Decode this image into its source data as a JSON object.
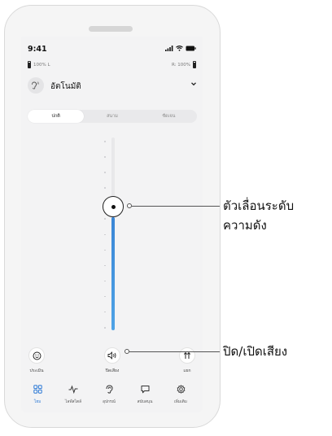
{
  "status_bar": {
    "time": "9:41"
  },
  "battery": {
    "left_label": "100% L",
    "right_label": "R: 100%"
  },
  "program": {
    "label": "อัตโนมัติ"
  },
  "tabs_segment": [
    {
      "label": "ปกติ",
      "active": true
    },
    {
      "label": "สนาม",
      "active": false
    },
    {
      "label": "ชัดเจน",
      "active": false
    }
  ],
  "volume": {
    "level_fraction": 0.58
  },
  "actions": {
    "left_label": "ประเมิน",
    "center_label": "ปิดเสียง",
    "right_label": "แยก"
  },
  "tab_bar": [
    {
      "label": "โฮม",
      "icon": "grid-icon",
      "active": true
    },
    {
      "label": "ไลฟ์สไตล์",
      "icon": "activity-icon",
      "active": false
    },
    {
      "label": "อุปกรณ์",
      "icon": "hearing-aid-icon",
      "active": false
    },
    {
      "label": "สนับสนุน",
      "icon": "chat-icon",
      "active": false
    },
    {
      "label": "เพิ่มเติม",
      "icon": "gear-icon",
      "active": false
    }
  ],
  "callouts": {
    "slider_line1": "ตัวเลื่อนระดับ",
    "slider_line2": "ความดัง",
    "mute": "ปิด/เปิดเสียง"
  },
  "colors": {
    "accent": "#2d7ad6",
    "fill": "#3a86d6"
  }
}
